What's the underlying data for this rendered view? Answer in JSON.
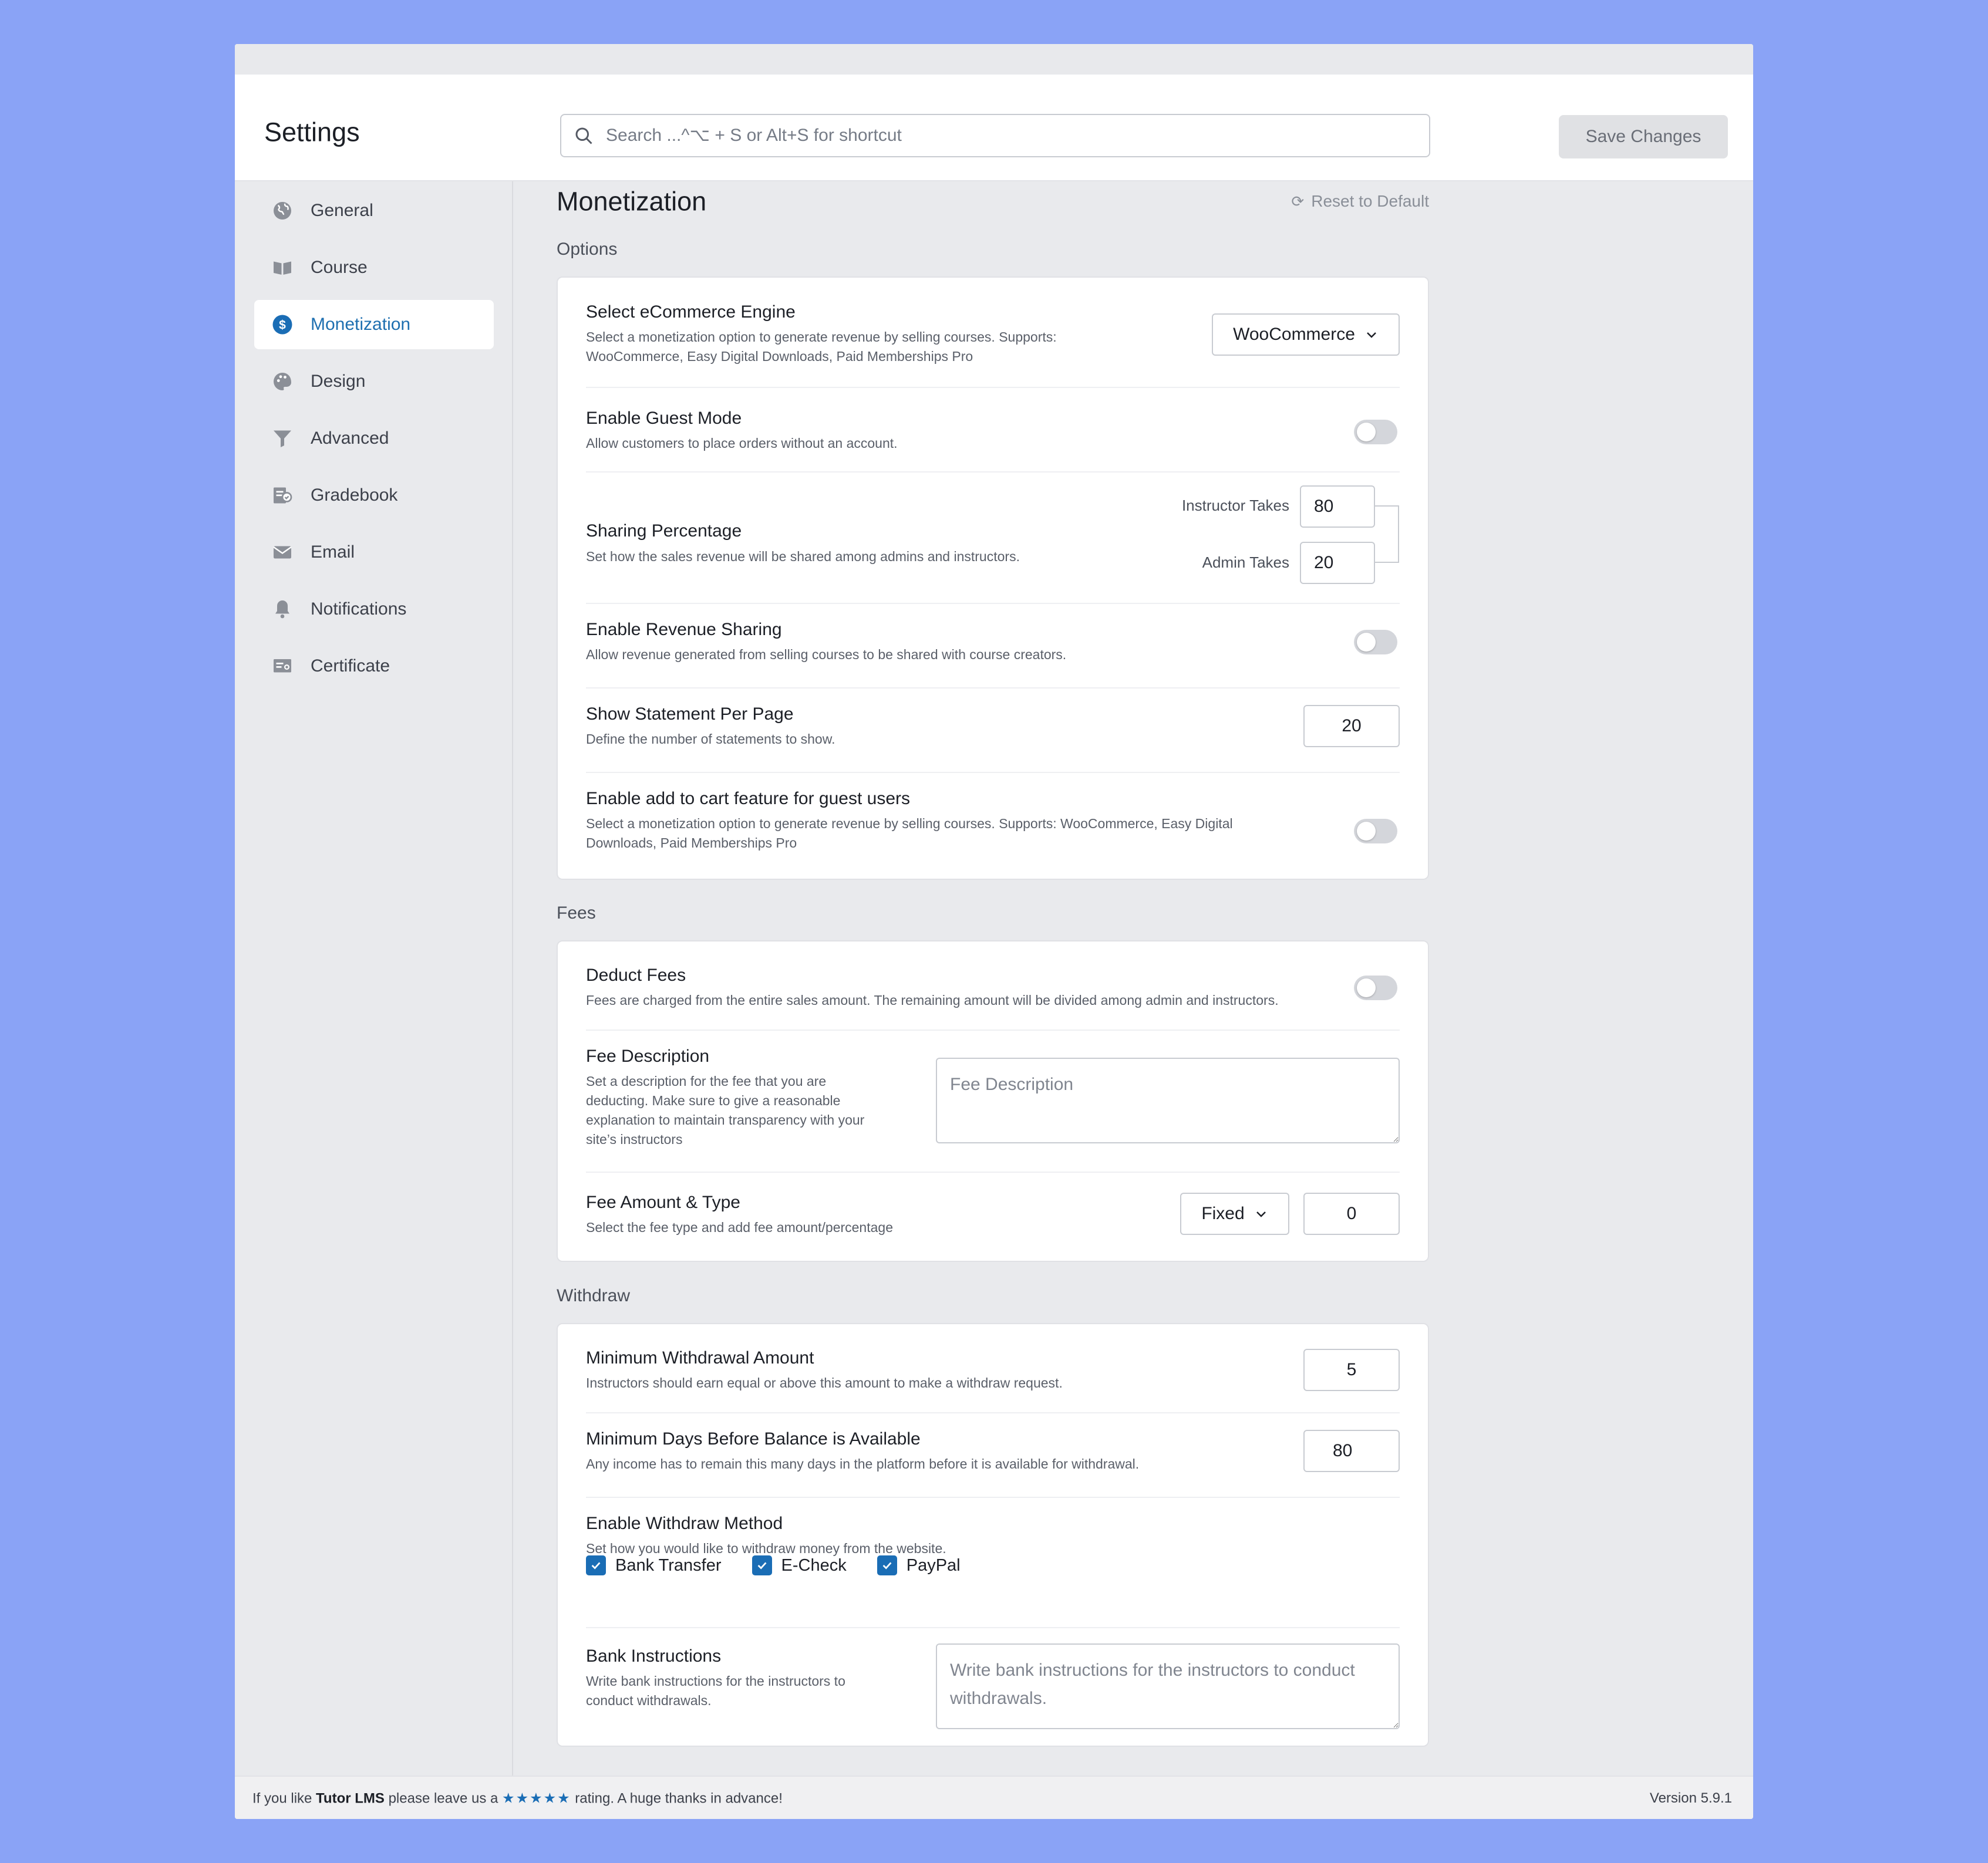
{
  "header": {
    "title": "Settings",
    "search_placeholder": "Search ...^⌥ + S or Alt+S for shortcut",
    "save_label": "Save Changes"
  },
  "sidebar": {
    "items": [
      {
        "label": "General",
        "icon": "globe-icon"
      },
      {
        "label": "Course",
        "icon": "book-icon"
      },
      {
        "label": "Monetization",
        "icon": "dollar-icon",
        "active": true
      },
      {
        "label": "Design",
        "icon": "palette-icon"
      },
      {
        "label": "Advanced",
        "icon": "filter-icon"
      },
      {
        "label": "Gradebook",
        "icon": "gradebook-icon"
      },
      {
        "label": "Email",
        "icon": "envelope-icon"
      },
      {
        "label": "Notifications",
        "icon": "bell-icon"
      },
      {
        "label": "Certificate",
        "icon": "certificate-icon"
      }
    ]
  },
  "main": {
    "title": "Monetization",
    "reset_label": "Reset to Default",
    "options": {
      "section_label": "Options",
      "ecommerce": {
        "label": "Select eCommerce Engine",
        "desc": "Select a monetization option to generate revenue by selling courses. Supports: WooCommerce, Easy Digital Downloads, Paid Memberships Pro",
        "value": "WooCommerce"
      },
      "guest_mode": {
        "label": "Enable Guest Mode",
        "desc": "Allow customers to place orders without an account.",
        "enabled": false
      },
      "sharing": {
        "label": "Sharing Percentage",
        "desc": "Set how the sales revenue will be shared among admins and instructors.",
        "instructor_label": "Instructor Takes",
        "instructor_value": "80",
        "admin_label": "Admin Takes",
        "admin_value": "20"
      },
      "revenue_sharing": {
        "label": "Enable Revenue Sharing",
        "desc": "Allow revenue generated from selling courses to be shared with course creators.",
        "enabled": false
      },
      "statements": {
        "label": "Show Statement Per Page",
        "desc": "Define the number of statements to show.",
        "value": "20"
      },
      "guest_cart": {
        "label": "Enable add to cart feature for guest users",
        "desc": "Select a monetization option to generate revenue by selling courses. Supports: WooCommerce, Easy Digital Downloads, Paid Memberships Pro",
        "enabled": false
      }
    },
    "fees": {
      "section_label": "Fees",
      "deduct": {
        "label": "Deduct Fees",
        "desc": "Fees are charged from the entire sales amount. The remaining amount will be divided among admin and instructors.",
        "enabled": false
      },
      "description": {
        "label": "Fee Description",
        "desc": "Set a description for the fee that you are deducting. Make sure to give a reasonable explanation to maintain transparency with your site’s instructors",
        "placeholder": "Fee Description"
      },
      "amount": {
        "label": "Fee Amount & Type",
        "desc": "Select the fee type and add fee amount/percentage",
        "type": "Fixed",
        "value": "0"
      }
    },
    "withdraw": {
      "section_label": "Withdraw",
      "minimum": {
        "label": "Minimum Withdrawal Amount",
        "desc": "Instructors should earn equal or above this amount to make a withdraw request.",
        "value": "5"
      },
      "days": {
        "label": "Minimum Days Before Balance is Available",
        "desc": "Any income has to remain this many days in the platform before it is available for withdrawal.",
        "value": "80"
      },
      "methods": {
        "label": "Enable Withdraw Method",
        "desc": "Set how you would like to withdraw money from the website.",
        "options": [
          {
            "label": "Bank Transfer",
            "checked": true
          },
          {
            "label": "E-Check",
            "checked": true
          },
          {
            "label": "PayPal",
            "checked": true
          }
        ]
      },
      "bank": {
        "label": "Bank Instructions",
        "desc": "Write bank instructions for the instructors to conduct withdrawals.",
        "placeholder": "Write bank instructions for the instructors to conduct withdrawals."
      }
    }
  },
  "footer": {
    "prefix": "If you like ",
    "brand": "Tutor LMS",
    "middle": " please leave us a ",
    "stars": "★★★★★",
    "suffix": " rating. A huge thanks in advance!",
    "version": "Version 5.9.1"
  },
  "colors": {
    "background": "#8AA3F6",
    "accent": "#1A6DB5",
    "toggle_off": "#D4D6DB"
  }
}
